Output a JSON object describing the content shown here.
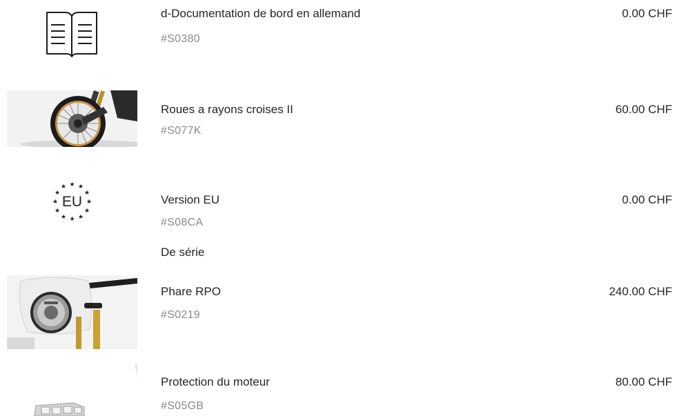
{
  "items": [
    {
      "title": "d-Documentation de bord en allemand",
      "code": "#S0380",
      "price": "0.00 CHF",
      "image_icon": "book-icon"
    },
    {
      "title": "Roues a rayons croises II",
      "code": "#S077K",
      "price": "60.00 CHF",
      "image_icon": "spoked-wheel-photo"
    },
    {
      "title": "Version EU",
      "code": "#S08CA",
      "price": "0.00 CHF",
      "note": "De série",
      "image_icon": "eu-stars-icon",
      "image_text": "EU"
    },
    {
      "title": "Phare RPO",
      "code": "#S0219",
      "price": "240.00 CHF",
      "image_icon": "headlight-photo"
    },
    {
      "title": "Protection du moteur",
      "code": "#S05GB",
      "price": "80.00 CHF",
      "image_icon": "engine-guard-photo"
    }
  ],
  "colors": {
    "text": "#262626",
    "code_text": "#8a8a8a",
    "wheel_rim": "#c8924a",
    "background": "#ffffff"
  }
}
